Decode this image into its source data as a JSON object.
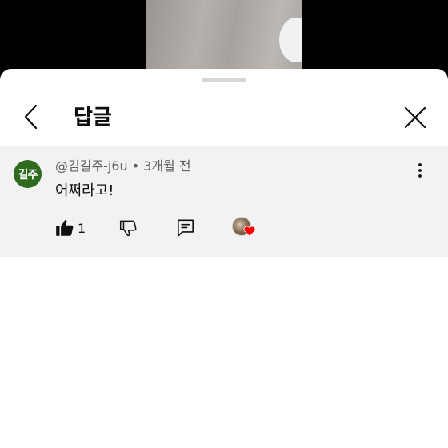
{
  "header": {
    "title": "답글"
  },
  "comment": {
    "avatar_text": "길주",
    "author": "@김길주-j6u",
    "separator": "•",
    "time": "3개월 전",
    "text": "어쩌라고!",
    "like_count": "1"
  },
  "colors": {
    "avatar_bg": "#2e6b1f",
    "comment_bg": "#f2f2f2",
    "heart": "#ff0000"
  },
  "icons": {
    "back": "chevron-left-icon",
    "close": "close-icon",
    "more": "more-vertical-icon",
    "like": "thumbs-up-icon",
    "dislike": "thumbs-down-icon",
    "reply": "reply-icon",
    "heart": "heart-icon"
  }
}
